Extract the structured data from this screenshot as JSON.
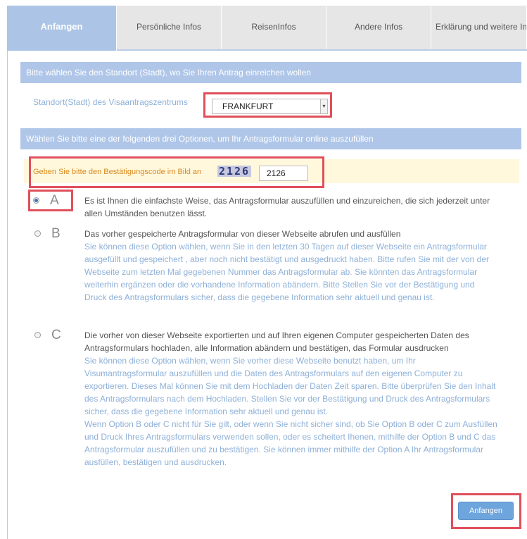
{
  "tabs": [
    "Anfangen",
    "Persönliche Infos",
    "ReisenInfos",
    "Andere Infos",
    "Erklärung und weitere Infos"
  ],
  "location_section": {
    "header": "Bitte wählen Sie den Standort (Stadt), wo Sie Ihren Antrag einreichen wollen",
    "label": "Standort(Stadt) des Visaantragszentrums",
    "selected_value": "FRANKFURT"
  },
  "options_section": {
    "header": "Wählen Sie bitte eine der folgenden drei Optionen, um Ihr Antragsformular online auszufüllen"
  },
  "captcha": {
    "label": "Geben Sie bitte den Bestätigungscode im Bild an",
    "image_code": "2126",
    "input_value": "2126"
  },
  "options": [
    {
      "letter": "A",
      "selected": true,
      "title": "Es ist Ihnen die einfachste Weise, das Antragsformular auszufüllen und einzureichen, die sich jederzeit unter allen Umständen benutzen lässt.",
      "description": ""
    },
    {
      "letter": "B",
      "selected": false,
      "title": "Das vorher gespeicherte Antragsformular von dieser Webseite abrufen und ausfüllen",
      "description": "Sie können diese Option wählen, wenn Sie in den letzten 30 Tagen auf dieser Webseite ein Antragsformular ausgefüllt und gespeichert , aber noch nicht bestätigt und ausgedruckt haben. Bitte rufen Sie mit der von der Webseite zum letzten Mal gegebenen Nummer das Antragsformular ab. Sie könnten das Antragsformular weiterhin ergänzen oder die vorhandene Information abändern. Bitte Stellen Sie vor der Bestätigung und Druck des Antragsformulars sicher, dass die gegebene Information sehr aktuell und genau ist."
    },
    {
      "letter": "C",
      "selected": false,
      "title": "Die vorher von dieser Webseite exportierten und auf Ihren eigenen Computer gespeicherten Daten des Antragsformulars hochladen, alle Information abändern und bestätigen, das Formular ausdrucken",
      "description": "Sie können diese Option wählen, wenn Sie vorher diese Webseite benutzt haben, um Ihr Visumantragsformular auszufüllen und die Daten des Antragsformulars auf den eigenen Computer zu exportieren. Dieses Mal können Sie mit dem Hochladen der Daten Zeit sparen. Bitte überprüfen Sie den Inhalt des Antragsformulars nach dem Hochladen. Stellen Sie vor der Bestätigung und Druck des Antragsformulars sicher, dass die gegebene Information sehr aktuell und genau ist.",
      "note": "Wenn Option B oder C nicht für Sie gilt, oder wenn Sie nicht sicher sind, ob Sie Option B oder C zum Ausfüllen und Druck Ihres Antragsformulars verwenden sollen, oder es scheitert Ihenen, mithilfe der Option B und C das Antragsformular auszufüllen und zu bestätigen. Sie können immer mithilfe der Option A Ihr Antragsformular ausfüllen, bestätigen und ausdrucken."
    }
  ],
  "start_button": "Anfangen",
  "colors": {
    "accent": "#acc4e6",
    "highlight_border": "#e0505b",
    "button": "#6ea5dc"
  }
}
